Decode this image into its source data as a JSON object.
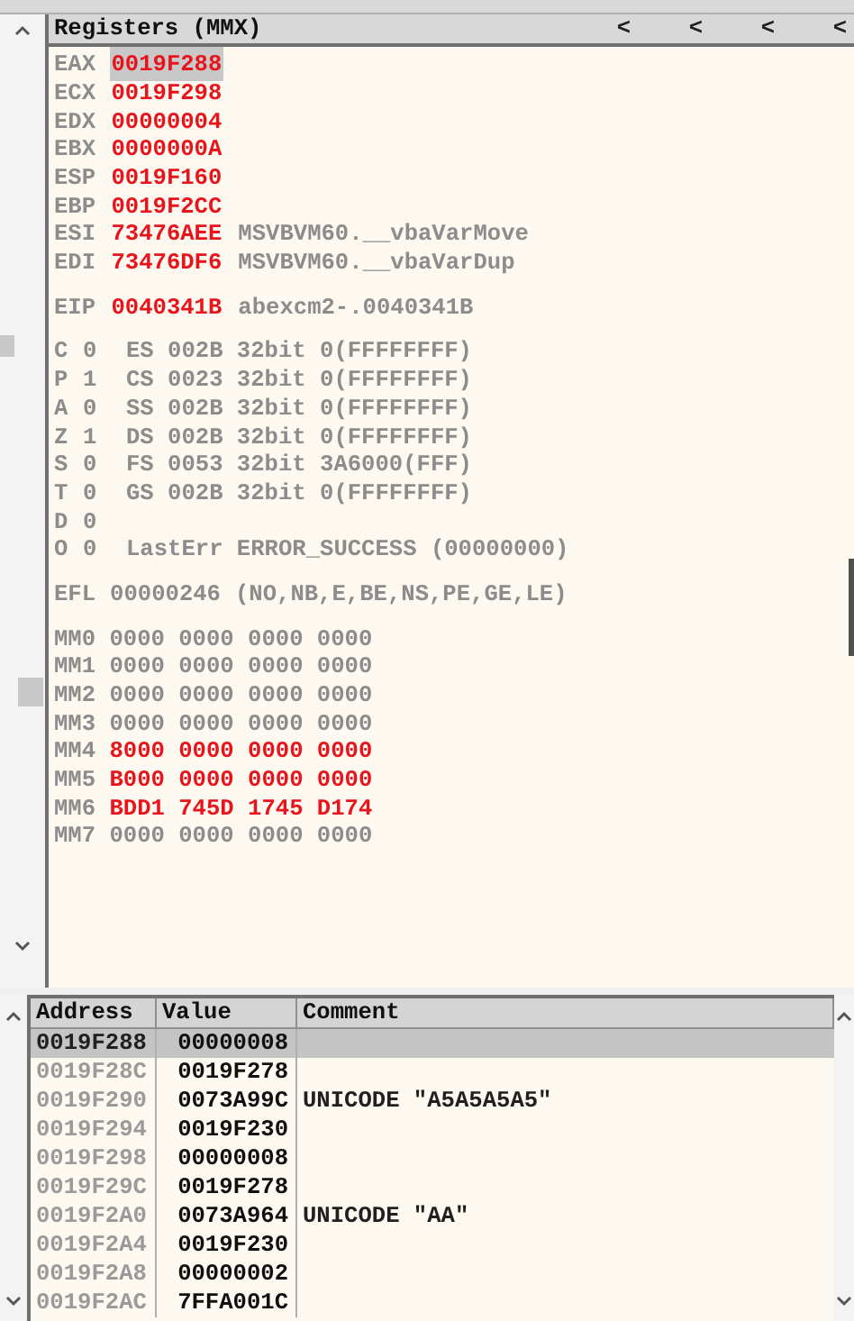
{
  "registers_pane": {
    "title": "Registers (MMX)",
    "header_buttons": [
      "<",
      "<",
      "<",
      "<"
    ],
    "general": [
      {
        "name": "EAX",
        "value": "0019F288",
        "changed": true,
        "selected": true
      },
      {
        "name": "ECX",
        "value": "0019F298",
        "changed": true,
        "selected": false
      },
      {
        "name": "EDX",
        "value": "00000004",
        "changed": true,
        "selected": false
      },
      {
        "name": "EBX",
        "value": "0000000A",
        "changed": true,
        "selected": false
      },
      {
        "name": "ESP",
        "value": "0019F160",
        "changed": true,
        "selected": false
      },
      {
        "name": "EBP",
        "value": "0019F2CC",
        "changed": true,
        "selected": false
      },
      {
        "name": "ESI",
        "value": "73476AEE",
        "changed": true,
        "selected": false,
        "comment": "MSVBVM60.__vbaVarMove"
      },
      {
        "name": "EDI",
        "value": "73476DF6",
        "changed": true,
        "selected": false,
        "comment": "MSVBVM60.__vbaVarDup"
      }
    ],
    "eip": {
      "name": "EIP",
      "value": "0040341B",
      "changed": true,
      "comment": "abexcm2-.0040341B"
    },
    "flags": [
      {
        "flag": "C",
        "bit": "0",
        "info": "ES 002B 32bit 0(FFFFFFFF)"
      },
      {
        "flag": "P",
        "bit": "1",
        "info": "CS 0023 32bit 0(FFFFFFFF)"
      },
      {
        "flag": "A",
        "bit": "0",
        "info": "SS 002B 32bit 0(FFFFFFFF)"
      },
      {
        "flag": "Z",
        "bit": "1",
        "info": "DS 002B 32bit 0(FFFFFFFF)"
      },
      {
        "flag": "S",
        "bit": "0",
        "info": "FS 0053 32bit 3A6000(FFF)"
      },
      {
        "flag": "T",
        "bit": "0",
        "info": "GS 002B 32bit 0(FFFFFFFF)"
      },
      {
        "flag": "D",
        "bit": "0"
      },
      {
        "flag": "O",
        "bit": "0",
        "info": "LastErr ERROR_SUCCESS (00000000)"
      }
    ],
    "efl": {
      "name": "EFL",
      "value": "00000246",
      "decoded": "(NO,NB,E,BE,NS,PE,GE,LE)"
    },
    "mmx": [
      {
        "name": "MM0",
        "value": "0000 0000 0000 0000",
        "changed": false
      },
      {
        "name": "MM1",
        "value": "0000 0000 0000 0000",
        "changed": false
      },
      {
        "name": "MM2",
        "value": "0000 0000 0000 0000",
        "changed": false
      },
      {
        "name": "MM3",
        "value": "0000 0000 0000 0000",
        "changed": false
      },
      {
        "name": "MM4",
        "value": "8000 0000 0000 0000",
        "changed": true
      },
      {
        "name": "MM5",
        "value": "B000 0000 0000 0000",
        "changed": true
      },
      {
        "name": "MM6",
        "value": "BDD1 745D 1745 D174",
        "changed": true
      },
      {
        "name": "MM7",
        "value": "0000 0000 0000 0000",
        "changed": false
      }
    ]
  },
  "stack_pane": {
    "columns": [
      "Address",
      "Value",
      "Comment"
    ],
    "rows": [
      {
        "address": "0019F288",
        "value": "00000008",
        "selected": true
      },
      {
        "address": "0019F28C",
        "value": "0019F278",
        "selected": false
      },
      {
        "address": "0019F290",
        "value": "0073A99C",
        "comment": "UNICODE \"A5A5A5A5\"",
        "selected": false
      },
      {
        "address": "0019F294",
        "value": "0019F230",
        "selected": false
      },
      {
        "address": "0019F298",
        "value": "00000008",
        "selected": false
      },
      {
        "address": "0019F29C",
        "value": "0019F278",
        "selected": false
      },
      {
        "address": "0019F2A0",
        "value": "0073A964",
        "comment": "UNICODE \"AA\"",
        "selected": false
      },
      {
        "address": "0019F2A4",
        "value": "0019F230",
        "selected": false
      },
      {
        "address": "0019F2A8",
        "value": "00000002",
        "selected": false
      },
      {
        "address": "0019F2AC",
        "value": "7FFA001C",
        "selected": false
      }
    ]
  }
}
